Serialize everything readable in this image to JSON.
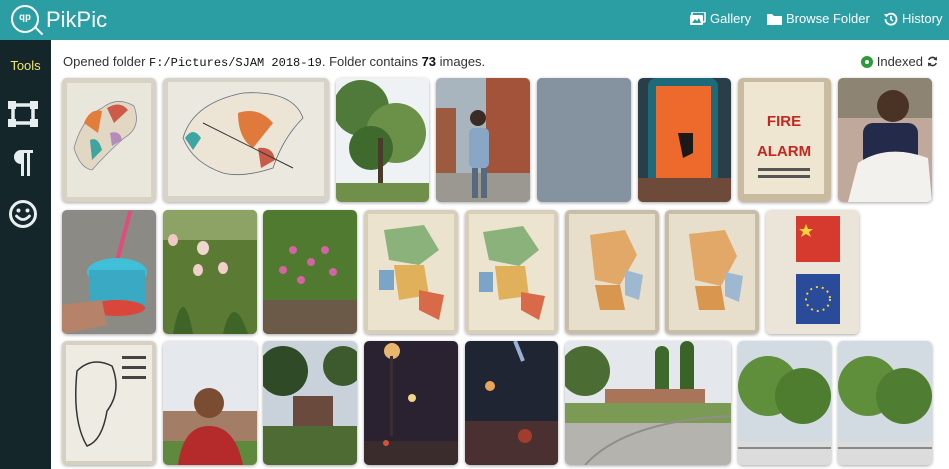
{
  "app": {
    "title": "PikPic",
    "logo_text": "qp"
  },
  "nav": {
    "gallery": "Gallery",
    "browse": "Browse Folder",
    "history": "History"
  },
  "sidebar": {
    "tools_label": "Tools"
  },
  "status": {
    "prefix": "Opened folder ",
    "folder": "F:/Pictures/SJAM 2018-19",
    "middle": ". Folder contains ",
    "count": "73",
    "suffix": " images."
  },
  "index": {
    "label": "Indexed",
    "color": "#2e9a3a"
  },
  "colors": {
    "topbar": "#2b9ea3",
    "sidebar": "#15262b",
    "tools_label": "#f0e46a"
  },
  "thumbnails": [
    {
      "subject": "hand-drawn map of Canada"
    },
    {
      "subject": "map of Canada on paper"
    },
    {
      "subject": "tree under sky"
    },
    {
      "subject": "boy by brick wall"
    },
    {
      "subject": "plain grey sky"
    },
    {
      "subject": "phone screen orange"
    },
    {
      "subject": "fire alarm sign"
    },
    {
      "subject": "boy with papers"
    },
    {
      "subject": "blue slushie cup"
    },
    {
      "subject": "tulip flowers"
    },
    {
      "subject": "pink bleeding-heart flowers"
    },
    {
      "subject": "coloured map of Europe"
    },
    {
      "subject": "coloured map of Europe"
    },
    {
      "subject": "map of Europe"
    },
    {
      "subject": "map of Europe"
    },
    {
      "subject": "flags of China and EU"
    },
    {
      "subject": "black and white map sketch"
    },
    {
      "subject": "selfie outdoors"
    },
    {
      "subject": "house with trees"
    },
    {
      "subject": "street at night"
    },
    {
      "subject": "blurry night lights"
    },
    {
      "subject": "road to school"
    },
    {
      "subject": "trees and fence"
    },
    {
      "subject": "trees and fence"
    }
  ]
}
